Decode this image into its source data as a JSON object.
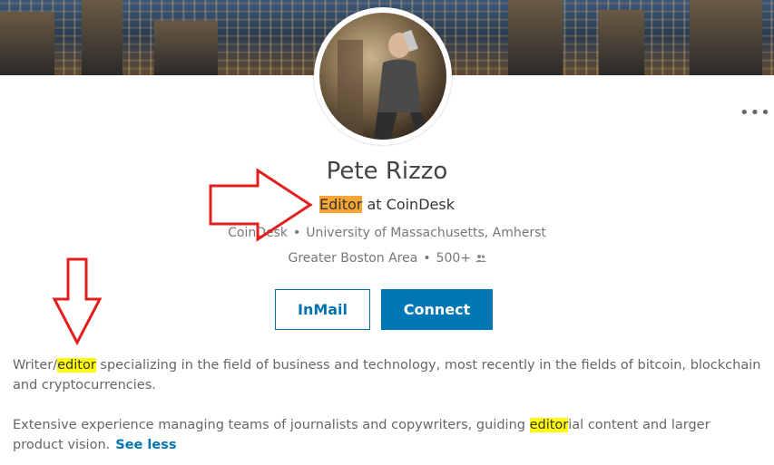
{
  "profile": {
    "name": "Pete Rizzo",
    "headline_highlight": "Editor",
    "headline_rest": " at CoinDesk",
    "company": "CoinDesk",
    "school": "University of Massachusetts, Amherst",
    "location": "Greater Boston Area",
    "connections": "500+",
    "more_glyph": "•••"
  },
  "actions": {
    "inmail_label": "InMail",
    "connect_label": "Connect"
  },
  "summary": {
    "p1_before": "Writer/",
    "p1_highlight": "editor",
    "p1_after": " specializing in the field of business and technology, most recently in the fields of bitcoin, blockchain and cryptocurrencies.",
    "p2_before": "Extensive experience managing teams of journalists and copywriters, guiding ",
    "p2_highlight": "editor",
    "p2_after": "ial content and larger product vision.",
    "see_less_label": "See less"
  },
  "colors": {
    "accent": "#0073b1",
    "connect_bg": "#0177b5",
    "highlight_orange": "#f7a535",
    "highlight_yellow": "#ffff00",
    "annotation_red": "#e41e1e"
  }
}
